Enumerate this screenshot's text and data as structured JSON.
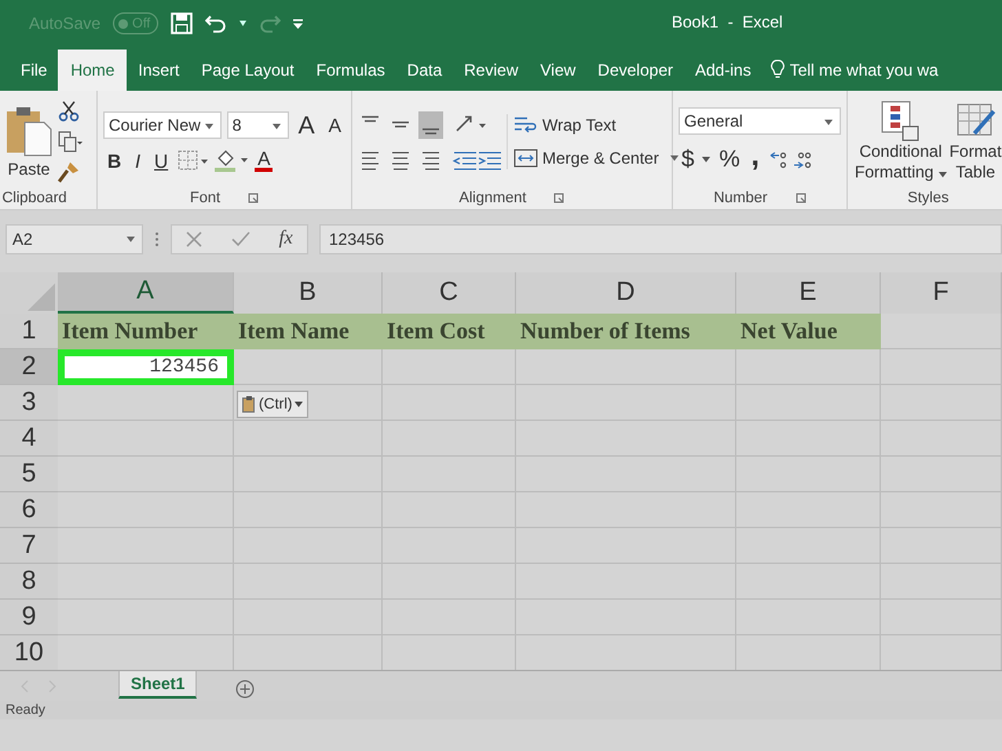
{
  "title_bar": {
    "autosave_label": "AutoSave",
    "autosave_toggle": {
      "label": "Off",
      "on": false
    },
    "redo_disabled": true,
    "title": "Book1  -  Excel"
  },
  "tabs": [
    {
      "label": "File",
      "selected": false
    },
    {
      "label": "Home",
      "selected": true
    },
    {
      "label": "Insert",
      "selected": false
    },
    {
      "label": "Page Layout",
      "selected": false
    },
    {
      "label": "Formulas",
      "selected": false
    },
    {
      "label": "Data",
      "selected": false
    },
    {
      "label": "Review",
      "selected": false
    },
    {
      "label": "View",
      "selected": false
    },
    {
      "label": "Developer",
      "selected": false
    },
    {
      "label": "Add-ins",
      "selected": false
    }
  ],
  "tell_me": "Tell me what you wa",
  "ribbon": {
    "clipboard": {
      "paste": "Paste",
      "group": "Clipboard"
    },
    "font": {
      "family": "Courier New",
      "size": "8",
      "grow": "A",
      "shrink": "A",
      "styles": [
        "B",
        "I",
        "U"
      ],
      "color_letter": "A",
      "group": "Font"
    },
    "alignment": {
      "wrap": "Wrap Text",
      "merge": "Merge & Center",
      "group": "Alignment"
    },
    "number": {
      "format": "General",
      "currency": "$",
      "percent": "%",
      "comma": ",",
      "group": "Number"
    },
    "styles": {
      "conditional": [
        "Conditional",
        "Formatting"
      ],
      "format_table": [
        "Format",
        "Table"
      ],
      "group": "Styles"
    }
  },
  "formula_bar": {
    "name_box": "A2",
    "fx": "fx",
    "formula": "123456"
  },
  "sheet": {
    "columns": [
      {
        "label": "A",
        "selected": true
      },
      {
        "label": "B",
        "selected": false
      },
      {
        "label": "C",
        "selected": false
      },
      {
        "label": "D",
        "selected": false
      },
      {
        "label": "E",
        "selected": false
      },
      {
        "label": "F",
        "selected": false
      }
    ],
    "rows": [
      {
        "label": "1",
        "selected": false,
        "kind": "header",
        "cells": [
          {
            "text": "Item Number",
            "selected": false
          },
          {
            "text": "Item Name",
            "selected": false
          },
          {
            "text": "Item Cost",
            "selected": false
          },
          {
            "text": "Number of Items",
            "selected": false
          },
          {
            "text": "Net Value",
            "selected": false
          }
        ]
      },
      {
        "label": "2",
        "selected": true,
        "kind": "data",
        "cells": [
          {
            "text": "123456",
            "selected": true
          }
        ]
      },
      {
        "label": "3",
        "selected": false,
        "cells": []
      },
      {
        "label": "4",
        "selected": false,
        "cells": []
      },
      {
        "label": "5",
        "selected": false,
        "cells": []
      },
      {
        "label": "6",
        "selected": false,
        "cells": []
      },
      {
        "label": "7",
        "selected": false,
        "cells": []
      },
      {
        "label": "8",
        "selected": false,
        "cells": []
      },
      {
        "label": "9",
        "selected": false,
        "cells": []
      },
      {
        "label": "10",
        "selected": false,
        "cells": []
      }
    ],
    "paste_options": "(Ctrl)"
  },
  "sheet_tabs": [
    {
      "label": "Sheet1",
      "selected": true
    }
  ],
  "status_bar": {
    "text": "Ready"
  }
}
